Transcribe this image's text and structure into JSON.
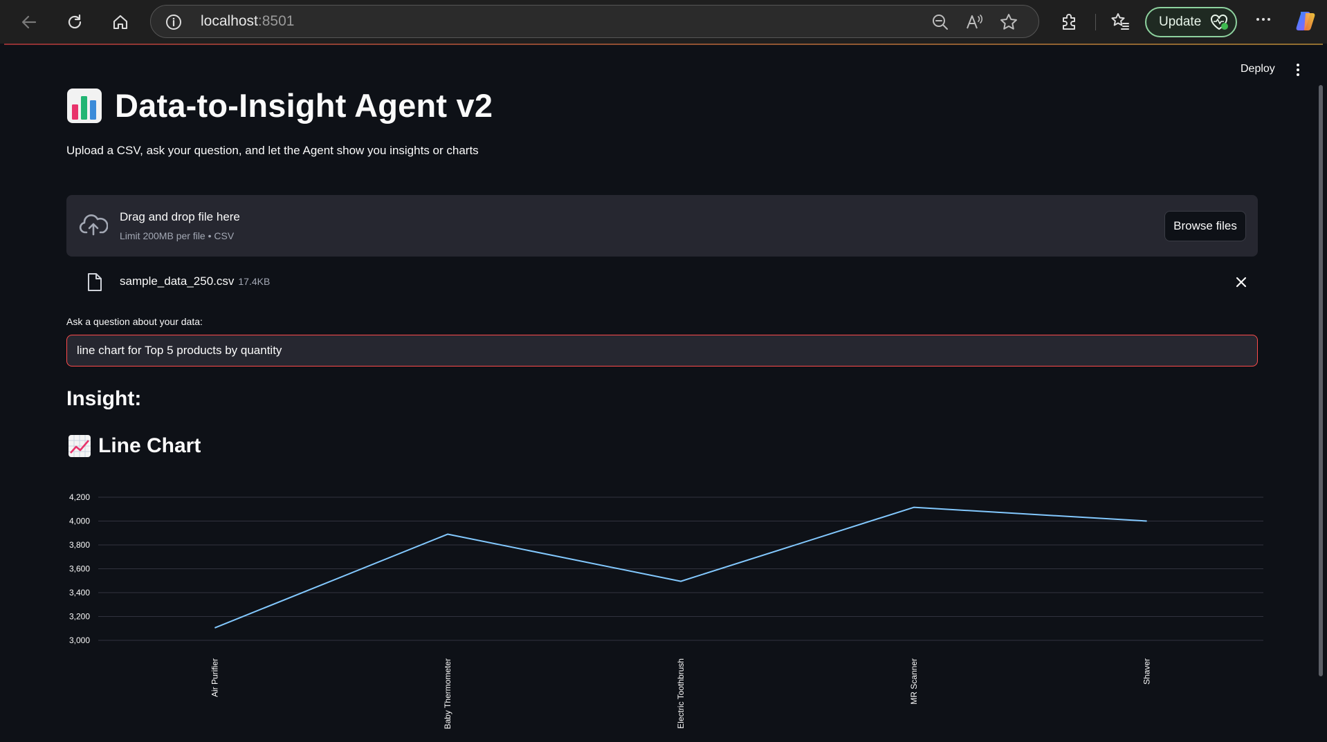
{
  "browser": {
    "url_host": "localhost",
    "url_port": ":8501",
    "update_label": "Update"
  },
  "app": {
    "deploy_label": "Deploy",
    "title": "Data-to-Insight Agent v2",
    "subtitle": "Upload a CSV, ask your question, and let the Agent show you insights or charts",
    "uploader": {
      "drop_title": "Drag and drop file here",
      "drop_subtitle": "Limit 200MB per file • CSV",
      "browse_label": "Browse files"
    },
    "file": {
      "name": "sample_data_250.csv",
      "size": "17.4KB"
    },
    "question": {
      "label": "Ask a question about your data:",
      "value": "line chart for Top 5 products by quantity"
    },
    "insight_heading": "Insight:",
    "chart_heading": "Line Chart"
  },
  "colors": {
    "accent": "#ff4b4b",
    "line": "#83c9ff",
    "background": "#0e1117",
    "panel": "#262730",
    "update_border": "#8ed29f"
  },
  "chart_data": {
    "type": "line",
    "categories": [
      "Air Purifier",
      "Baby Thermometer",
      "Electric Toothbrush",
      "MR Scanner",
      "Shaver"
    ],
    "values": [
      3105,
      3890,
      3495,
      4115,
      4000
    ],
    "ylim": [
      3000,
      4200
    ],
    "yticks": [
      3000,
      3200,
      3400,
      3600,
      3800,
      4000,
      4200
    ],
    "ytick_labels": [
      "3,000",
      "3,200",
      "3,400",
      "3,600",
      "3,800",
      "4,000",
      "4,200"
    ],
    "grid": true,
    "title": "",
    "xlabel": "",
    "ylabel": ""
  }
}
